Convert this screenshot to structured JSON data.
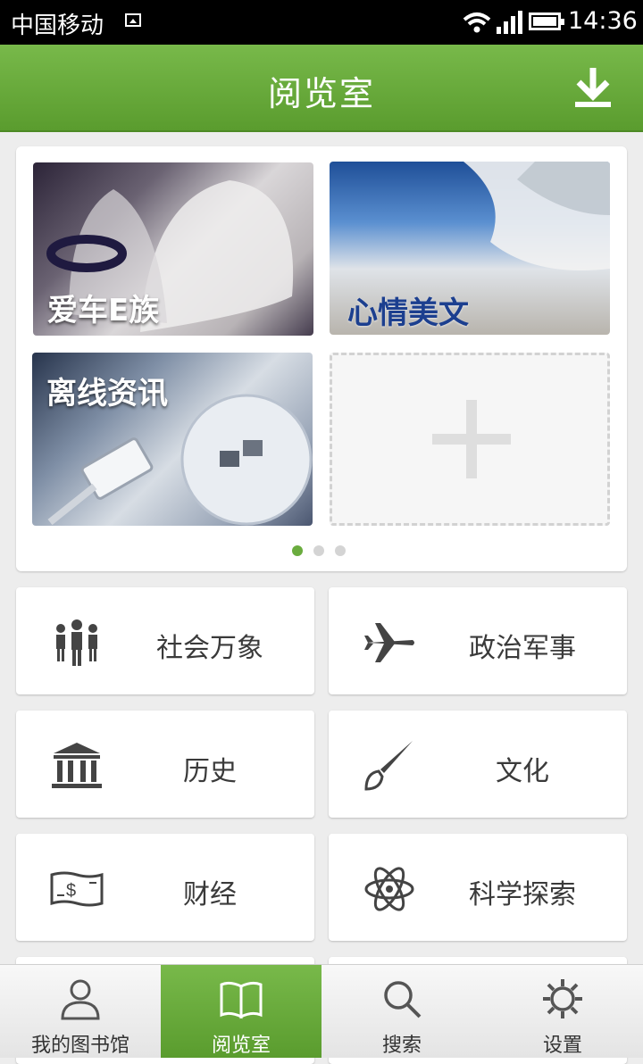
{
  "status_bar": {
    "carrier": "中国移动",
    "time": "14:36"
  },
  "header": {
    "title": "阅览室",
    "download_icon": "download-icon"
  },
  "carousel": {
    "tiles": [
      {
        "label": "爱车E族",
        "label_color": "#ffffff"
      },
      {
        "label": "心情美文",
        "label_color": "#1c3f8f"
      },
      {
        "label": "离线资讯",
        "label_color": "#ffffff"
      }
    ],
    "add_tile_icon": "plus-icon",
    "page_count": 3,
    "active_page": 0
  },
  "categories": [
    {
      "label": "社会万象",
      "icon": "people-icon"
    },
    {
      "label": "政治军事",
      "icon": "airplane-icon"
    },
    {
      "label": "历史",
      "icon": "museum-icon"
    },
    {
      "label": "文化",
      "icon": "paintbrush-icon"
    },
    {
      "label": "财经",
      "icon": "money-icon"
    },
    {
      "label": "科学探索",
      "icon": "atom-icon"
    }
  ],
  "bottom_nav": [
    {
      "label": "我的图书馆",
      "icon": "user-icon",
      "active": false
    },
    {
      "label": "阅览室",
      "icon": "book-icon",
      "active": true
    },
    {
      "label": "搜索",
      "icon": "search-icon",
      "active": false
    },
    {
      "label": "设置",
      "icon": "gear-icon",
      "active": false
    }
  ],
  "colors": {
    "accent": "#5fa133",
    "title_text": "#ffffff"
  }
}
